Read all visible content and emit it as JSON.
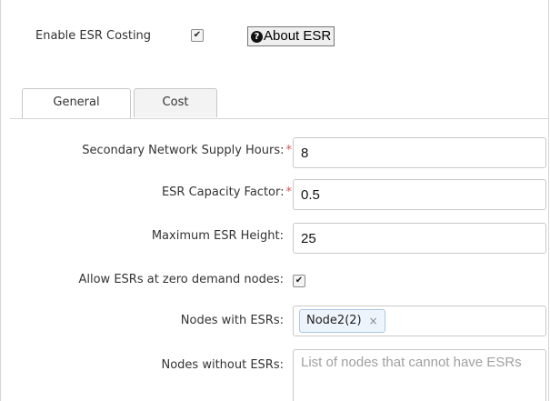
{
  "header": {
    "enable_esr_label": "Enable ESR Costing",
    "enable_esr_checked": true,
    "about_button_label": "About ESR",
    "about_icon": "question-circle-icon"
  },
  "tabs": [
    {
      "label": "General",
      "active": true
    },
    {
      "label": "Cost",
      "active": false
    }
  ],
  "form": {
    "secondary_supply_hours": {
      "label": "Secondary Network Supply Hours:",
      "required": true,
      "value": "8"
    },
    "capacity_factor": {
      "label": "ESR Capacity Factor:",
      "required": true,
      "value": "0.5"
    },
    "max_height": {
      "label": "Maximum ESR Height:",
      "required": false,
      "value": "25"
    },
    "allow_zero_demand": {
      "label": "Allow ESRs at zero demand nodes:",
      "checked": true
    },
    "nodes_with_esrs": {
      "label": "Nodes with ESRs:",
      "tags": [
        "Node2(2)"
      ],
      "remove_glyph": "×"
    },
    "nodes_without_esrs": {
      "label": "Nodes without ESRs:",
      "placeholder": "List of nodes that cannot have ESRs"
    }
  },
  "required_marker": "*",
  "check_glyph": "✔",
  "colors": {
    "required": "#d9534f",
    "tag_bg": "#eef4fb",
    "tag_border": "#a9c7e6"
  }
}
